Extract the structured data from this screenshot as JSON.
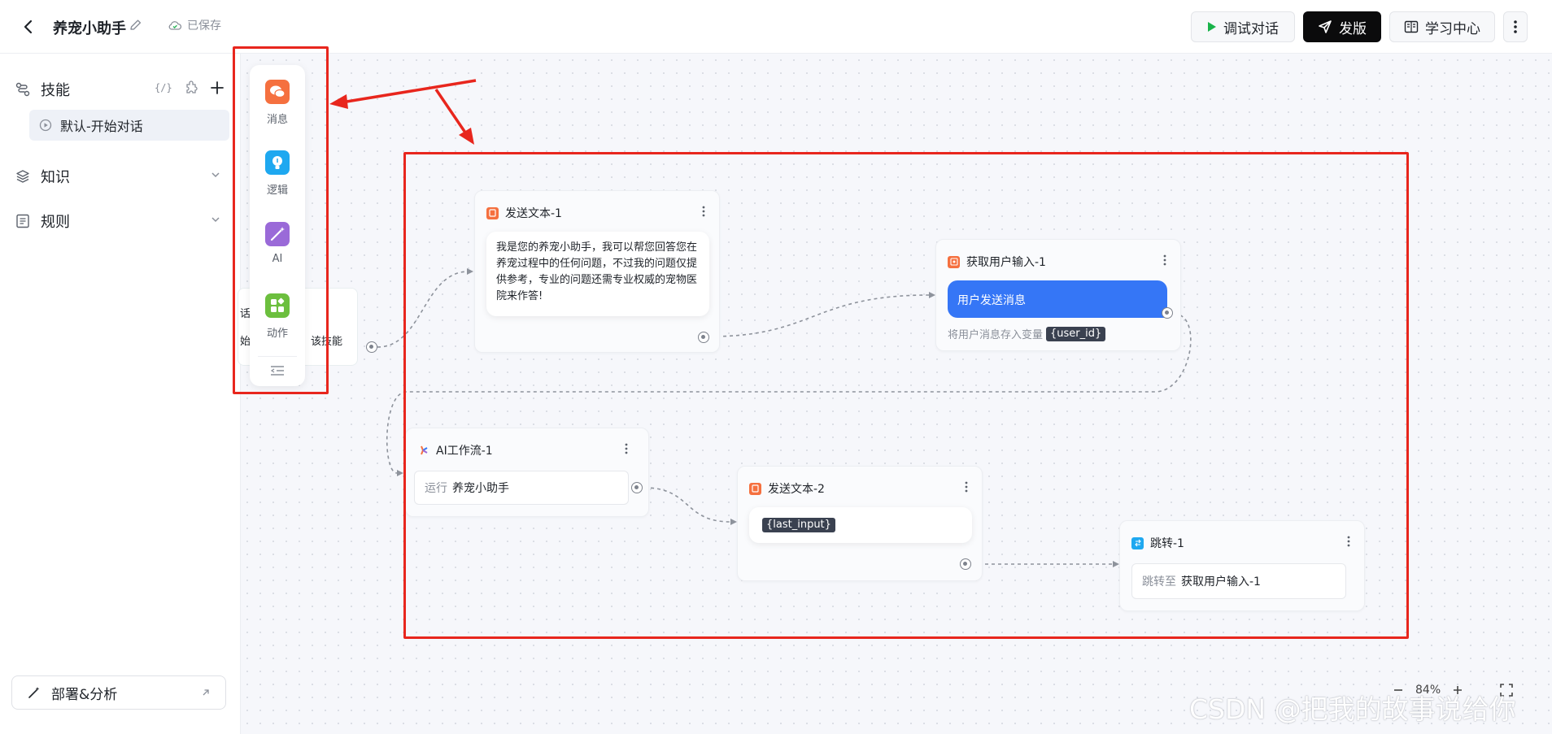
{
  "header": {
    "title": "养宠小助手",
    "save_status": "已保存",
    "debug_label": "调试对话",
    "publish_label": "发版",
    "learn_label": "学习中心"
  },
  "sidebar": {
    "skills_label": "技能",
    "skills_code_label": "{/}",
    "skill_item": "默认-开始对话",
    "knowledge_label": "知识",
    "rules_label": "规则",
    "deploy_label": "部署&分析"
  },
  "palette": {
    "items": [
      {
        "label": "消息",
        "icon": "chat-icon",
        "color": "#f5703f"
      },
      {
        "label": "逻辑",
        "icon": "bulb-icon",
        "color": "#1ea8f0"
      },
      {
        "label": "AI",
        "icon": "magic-wand-icon",
        "color": "#9a6ad8"
      },
      {
        "label": "动作",
        "icon": "blocks-icon",
        "color": "#6cbf3e"
      }
    ]
  },
  "start_node": {
    "line1": "话",
    "line2": "始",
    "line3": "该技能"
  },
  "nodes": {
    "send_text_1": {
      "title": "发送文本-1",
      "message": "我是您的养宠小助手，我可以帮您回答您在养宠过程中的任何问题，不过我的问题仅提供参考，专业的问题还需专业权威的宠物医院来作答!"
    },
    "get_input_1": {
      "title": "获取用户输入-1",
      "button": "用户发送消息",
      "note": "将用户消息存入变量",
      "variable": "{user_id}"
    },
    "ai_workflow_1": {
      "title": "AI工作流-1",
      "run_label": "运行",
      "run_value": "养宠小助手"
    },
    "send_text_2": {
      "title": "发送文本-2",
      "variable": "{last_input}"
    },
    "jump_1": {
      "title": "跳转-1",
      "jump_label": "跳转至",
      "jump_target": "获取用户输入-1"
    }
  },
  "zoom": {
    "value": "84%"
  },
  "watermark": "CSDN @把我的故事说给你",
  "colors": {
    "accent_blue": "#3576f6",
    "annotation_red": "#e8261d",
    "publish_bg": "#0b0b0c"
  }
}
